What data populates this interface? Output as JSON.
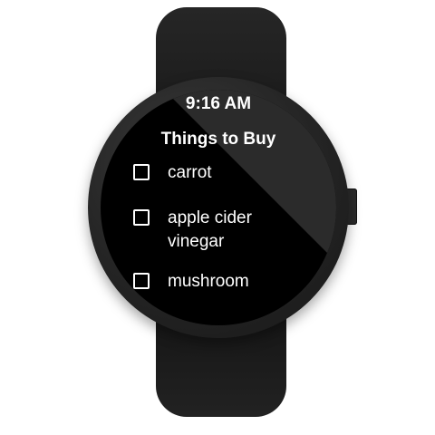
{
  "watch": {
    "time": "9:16 AM",
    "list_title": "Things to Buy",
    "items": [
      {
        "label": "carrot",
        "checked": false
      },
      {
        "label": "apple cider vinegar",
        "checked": false
      },
      {
        "label": "mushroom",
        "checked": false
      }
    ]
  },
  "colors": {
    "strap": "#1e1e1e",
    "bezel": "#2a2a2a",
    "screen_bg": "#000000",
    "text": "#ffffff"
  }
}
